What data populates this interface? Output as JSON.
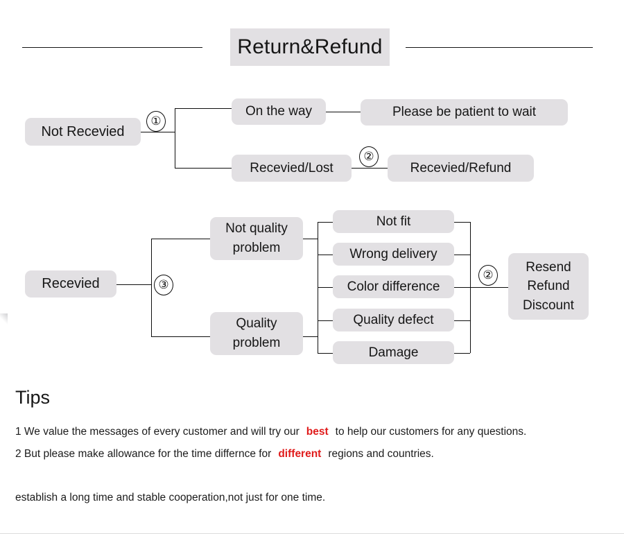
{
  "header": {
    "title": "Return&Refund",
    "rule_left": "horizontal-rule",
    "rule_right": "horizontal-rule"
  },
  "flow_not_received": {
    "root": "Not Recevied",
    "marker_root": "①",
    "branches": [
      {
        "label": "On the way",
        "outcome": "Please be patient to wait",
        "marker": ""
      },
      {
        "label": "Recevied/Lost",
        "outcome": "Recevied/Refund",
        "marker": "②"
      }
    ]
  },
  "flow_received": {
    "root": "Recevied",
    "marker_root": "③",
    "categories": [
      {
        "line1": "Not quality",
        "line2": "problem"
      },
      {
        "line1": "Quality",
        "line2": "problem"
      }
    ],
    "reasons": [
      "Not fit",
      "Wrong delivery",
      "Color difference",
      "Quality defect",
      "Damage"
    ],
    "marker_outcome": "②",
    "outcome": {
      "line1": "Resend",
      "line2": "Refund",
      "line3": "Discount"
    }
  },
  "tips": {
    "heading": "Tips",
    "line1": {
      "prefix": "1 We value the messages of every customer and will try our",
      "highlight": "best",
      "suffix": "to help our customers for any questions."
    },
    "line2": {
      "prefix": "2 But please make allowance for the time differnce for",
      "highlight": "different",
      "suffix": "regions and countries."
    },
    "line3": "establish a long time  and stable cooperation,not just for one time."
  },
  "colors": {
    "node_fill": "#e2e0e3",
    "line": "#0d0d0d",
    "highlight": "#e01b1b",
    "text": "#161616",
    "background": "#ffffff"
  }
}
